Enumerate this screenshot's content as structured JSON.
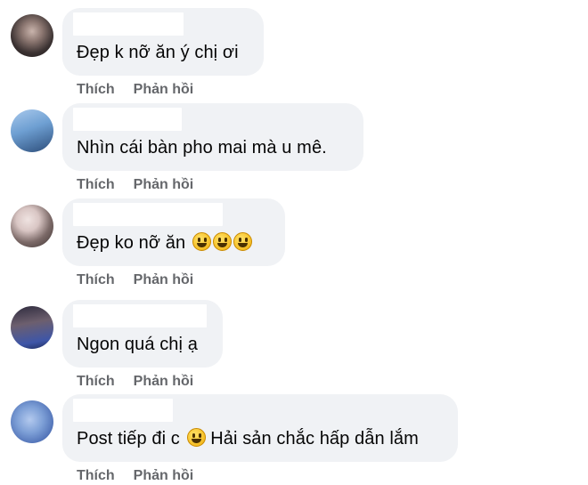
{
  "comments": [
    {
      "text": "Đẹp k nỡ ăn ý chị ơi",
      "emoji_count": 0,
      "like_label": "Thích",
      "reply_label": "Phản hồi",
      "avatar_colors": [
        "#3b3232",
        "#b9a8a0"
      ]
    },
    {
      "text": "Nhìn cái bàn pho mai mà u mê.",
      "emoji_count": 0,
      "like_label": "Thích",
      "reply_label": "Phản hồi",
      "avatar_colors": [
        "#6e9fd2",
        "#2c4d7a"
      ]
    },
    {
      "text": "Đẹp ko nỡ ăn",
      "emoji_count": 3,
      "like_label": "Thích",
      "reply_label": "Phản hồi",
      "avatar_colors": [
        "#d9c6c4",
        "#3a302f"
      ]
    },
    {
      "text": "Ngon quá chị ạ",
      "emoji_count": 0,
      "like_label": "Thích",
      "reply_label": "Phản hồi",
      "avatar_colors": [
        "#2d2a3d",
        "#3e56a8"
      ]
    },
    {
      "text_before": "Post tiếp đi c",
      "text_after": " Hải sản chắc hấp dẫn lắm",
      "emoji_count": 1,
      "like_label": "Thích",
      "reply_label": "Phản hồi",
      "avatar_colors": [
        "#7d9fd6",
        "#4e6fb5"
      ]
    }
  ]
}
